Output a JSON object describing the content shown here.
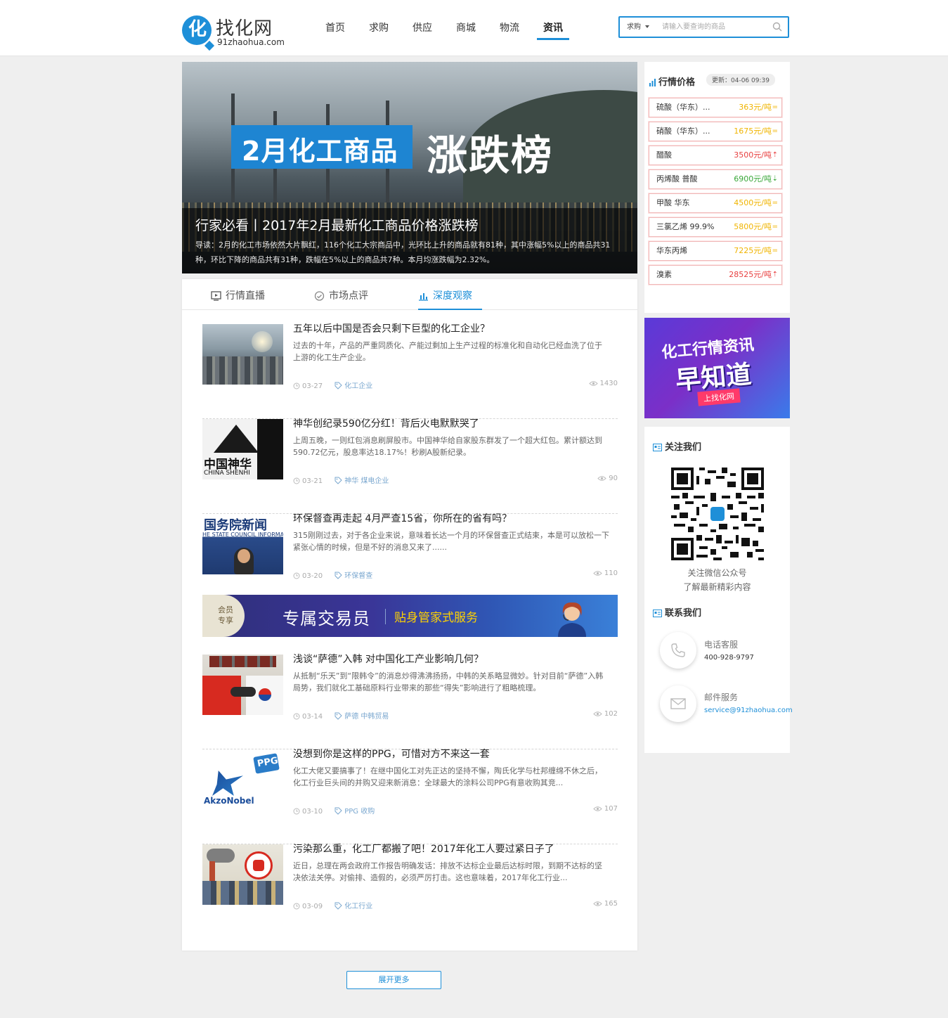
{
  "site": {
    "logo_glyph": "化",
    "name": "找化网",
    "domain": "91zhaohua.com"
  },
  "nav": [
    {
      "label": "首页",
      "active": false
    },
    {
      "label": "求购",
      "active": false
    },
    {
      "label": "供应",
      "active": false
    },
    {
      "label": "商城",
      "active": false
    },
    {
      "label": "物流",
      "active": false
    },
    {
      "label": "资讯",
      "active": true
    }
  ],
  "search": {
    "type": "求购",
    "placeholder": "请输入要查询的商品",
    "icon": "search-icon"
  },
  "banner": {
    "tag": "2月化工商品",
    "big": "涨跌榜",
    "headline": "行家必看丨2017年2月最新化工商品价格涨跌榜",
    "lead": "导读：2月的化工市场依然大片飘红，116个化工大宗商品中，光环比上升的商品就有81种，其中涨幅5%以上的商品共31种，环比下降的商品共有31种，跌幅在5%以上的商品共7种。本月均涨跌幅为2.32%。"
  },
  "tabs": [
    {
      "label": "行情直播",
      "icon": "tv-icon",
      "active": false
    },
    {
      "label": "市场点评",
      "icon": "comment-icon",
      "active": false
    },
    {
      "label": "深度观察",
      "icon": "chart-icon",
      "active": true
    }
  ],
  "articles": [
    {
      "title": "五年以后中国是否会只剩下巨型的化工企业？",
      "summary": "过去的十年，产品的严重同质化、产能过剩加上生产过程的标准化和自动化已经血洗了位于上游的化工生产企业。",
      "date": "03-27",
      "tags": "化工企业",
      "views": "1430"
    },
    {
      "title": "神华创纪录590亿分红！背后火电默默哭了",
      "summary": "上周五晚，一则红包消息刷屏股市。中国神华给自家股东群发了一个超大红包。累计额达到590.72亿元，股息率达18.17%！秒刷A股新纪录。",
      "date": "03-21",
      "tags": "神华  煤电企业",
      "views": "90",
      "thumb_text_1": "中国神华",
      "thumb_text_2": "CHINA SHENHI"
    },
    {
      "title": "环保督查再走起 4月严查15省，你所在的省有吗？",
      "summary": "315刚刚过去，对于各企业来说，意味着长达一个月的环保督查正式结束，本是可以放松一下紧张心情的时候，但是不好的消息又来了......",
      "date": "03-20",
      "tags": "环保督查",
      "views": "110",
      "thumb_text_1": "国务院新闻",
      "thumb_text_2": "HE STATE COUNCIL INFORMAT"
    },
    {
      "title": "浅谈“萨德”入韩 对中国化工产业影响几何？",
      "summary": "从抵制“乐天”到“限韩令”的消息炒得沸沸扬扬，中韩的关系略显微妙。针对目前“萨德”入韩局势，我们就化工基础原料行业带来的那些“得失”影响进行了粗略梳理。",
      "date": "03-14",
      "tags": "萨德  中韩贸易",
      "views": "102"
    },
    {
      "title": "没想到你是这样的PPG，可惜对方不来这一套",
      "summary": "化工大佬又要搞事了！在继中国化工对先正达的坚持不懈，陶氏化学与杜邦缠绵不休之后，化工行业巨头间的并购又迎来新消息：全球最大的涂料公司PPG有意收购其竞...",
      "date": "03-10",
      "tags": "PPG  收购",
      "views": "107",
      "thumb_text_1": "PPG",
      "thumb_text_2": "AkzoNobel"
    },
    {
      "title": "污染那么重，化工厂都搬了吧！2017年化工人要过紧日子了",
      "summary": "近日，总理在两会政府工作报告明确发话：排放不达标企业最后达标时限，到期不达标的坚决依法关停。对偷排、造假的，必须严厉打击。这也意味着，2017年化工行业...",
      "date": "03-09",
      "tags": "化工行业",
      "views": "165"
    }
  ],
  "vip_banner": {
    "badge": "会员专享",
    "main": "专属交易员",
    "sub": "贴身管家式服务"
  },
  "more_label": "展开更多",
  "prices": {
    "title": "行情价格",
    "update": "更新：04-06 09:39",
    "rows": [
      {
        "name": "硫酸（华东）...",
        "value": "363元/吨",
        "trend": "=",
        "color": "#f0b400"
      },
      {
        "name": "硝酸（华东）...",
        "value": "1675元/吨",
        "trend": "=",
        "color": "#f0b400"
      },
      {
        "name": "醋酸",
        "value": "3500元/吨",
        "trend": "⇡",
        "color": "#e84040"
      },
      {
        "name": "丙烯酸 普酸",
        "value": "6900元/吨",
        "trend": "⇣",
        "color": "#3aa83a"
      },
      {
        "name": "甲酸 华东",
        "value": "4500元/吨",
        "trend": "=",
        "color": "#f0b400"
      },
      {
        "name": "三氯乙烯 99.9%",
        "value": "5800元/吨",
        "trend": "=",
        "color": "#f0b400"
      },
      {
        "name": "华东丙烯",
        "value": "7225元/吨",
        "trend": "=",
        "color": "#f0b400"
      },
      {
        "name": "溴素",
        "value": "28525元/吨",
        "trend": "⇡",
        "color": "#e84040"
      }
    ]
  },
  "ad": {
    "line1": "化工行情资讯",
    "line2": "早知道",
    "line3": "上找化网"
  },
  "follow": {
    "title": "关注我们",
    "caption1": "关注微信公众号",
    "caption2": "了解最新精彩内容"
  },
  "contact": {
    "title": "联系我们",
    "phone_label": "电话客服",
    "phone": "400-928-9797",
    "email_label": "邮件服务",
    "email": "service@91zhaohua.com"
  }
}
